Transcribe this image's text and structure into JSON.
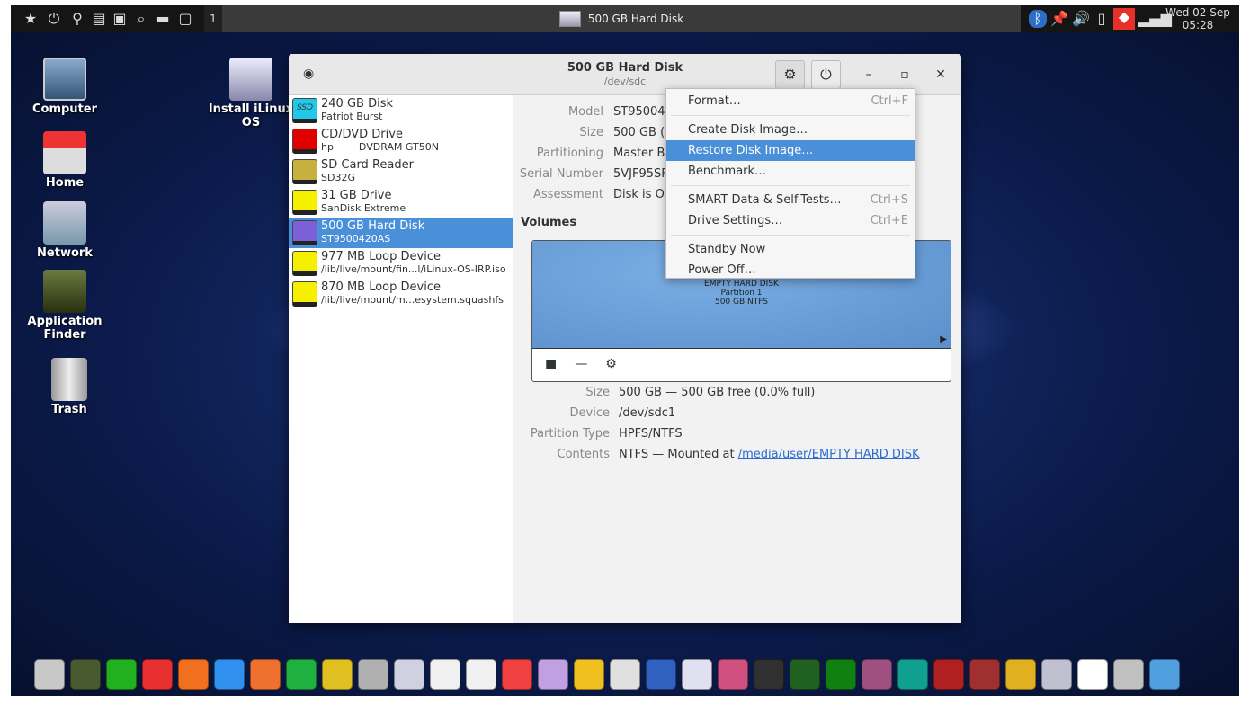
{
  "topbar": {
    "workspace": "1",
    "task_title": "500 GB Hard Disk",
    "clock_day": "Wed 02 Sep",
    "clock_time": "05:28",
    "launcher_icons": [
      "star-icon",
      "power-icon",
      "binoculars-icon",
      "drive-icon",
      "disk-utility-icon",
      "search-icon",
      "folder-icon",
      "window-icon"
    ],
    "tray_icons": [
      "bluetooth-icon",
      "pin-icon",
      "volume-icon",
      "battery-icon",
      "anydesk-icon",
      "signal-icon"
    ]
  },
  "desktop": {
    "icons": [
      {
        "label": "Computer"
      },
      {
        "label": "Install iLinux OS"
      },
      {
        "label": "Home"
      },
      {
        "label": "Network"
      },
      {
        "label": "Application Finder"
      },
      {
        "label": "Trash"
      }
    ]
  },
  "window": {
    "title": "500 GB Hard Disk",
    "subtitle": "/dev/sdc",
    "drives": [
      {
        "name": "240 GB Disk",
        "detail": "Patriot Burst",
        "icon": "ssd-icon",
        "color": "#22c8e8",
        "badge": "SSD"
      },
      {
        "name": "CD/DVD Drive",
        "detail": "hp        DVDRAM GT50N",
        "icon": "optical-drive-icon",
        "color": "#e00000"
      },
      {
        "name": "SD Card Reader",
        "detail": "SD32G",
        "icon": "sd-card-icon",
        "color": "#c8b040"
      },
      {
        "name": "31 GB Drive",
        "detail": "SanDisk Extreme",
        "icon": "drive-icon",
        "color": "#f5f000"
      },
      {
        "name": "500 GB Hard Disk",
        "detail": "ST9500420AS",
        "icon": "usb-drive-icon",
        "color": "#7b60d8",
        "selected": true
      },
      {
        "name": "977 MB Loop Device",
        "detail": "/lib/live/mount/fin...l/iLinux-OS-IRP.iso",
        "icon": "drive-icon",
        "color": "#f5f000"
      },
      {
        "name": "870 MB Loop Device",
        "detail": "/lib/live/mount/m...esystem.squashfs",
        "icon": "drive-icon",
        "color": "#f5f000"
      }
    ],
    "disk_info": [
      {
        "key": "Model",
        "value": "ST9500420AS (D005SDM1)"
      },
      {
        "key": "Size",
        "value": "500 GB (500,107,861,504 bytes)"
      },
      {
        "key": "Partitioning",
        "value": "Master Boot Record"
      },
      {
        "key": "Serial Number",
        "value": "5VJF95SF"
      },
      {
        "key": "Assessment",
        "value": "Disk is OK (28° C / 82° F)"
      }
    ],
    "volumes_heading": "Volumes",
    "partition": {
      "label": "EMPTY HARD DISK",
      "name": "Partition 1",
      "size": "500 GB NTFS"
    },
    "volume_info": [
      {
        "key": "Size",
        "value": "500 GB — 500 GB free (0.0% full)"
      },
      {
        "key": "Device",
        "value": "/dev/sdc1"
      },
      {
        "key": "Partition Type",
        "value": "HPFS/NTFS"
      },
      {
        "key": "Contents",
        "value": "NTFS — Mounted at ",
        "link": "/media/user/EMPTY HARD DISK"
      }
    ]
  },
  "menu": {
    "items": [
      {
        "label": "Format…",
        "shortcut": "Ctrl+F"
      },
      {
        "label": "Create Disk Image…",
        "shortcut": ""
      },
      {
        "label": "Restore Disk Image…",
        "shortcut": "",
        "highlighted": true
      },
      {
        "label": "Benchmark…",
        "shortcut": ""
      },
      {
        "label": "SMART Data & Self-Tests…",
        "shortcut": "Ctrl+S"
      },
      {
        "label": "Drive Settings…",
        "shortcut": "Ctrl+E"
      },
      {
        "label": "Standby Now",
        "shortcut": ""
      },
      {
        "label": "Power Off…",
        "shortcut": ""
      }
    ]
  },
  "dock": {
    "icons": [
      {
        "name": "file-cabinet-icon",
        "color": "#c8c8c8"
      },
      {
        "name": "binoculars-icon",
        "color": "#4a5a30"
      },
      {
        "name": "pipe-icon",
        "color": "#20b020"
      },
      {
        "name": "anydesk-icon",
        "color": "#e83030"
      },
      {
        "name": "firefox-icon",
        "color": "#f07020"
      },
      {
        "name": "wps-writer-icon",
        "color": "#3090f0"
      },
      {
        "name": "wps-presentation-icon",
        "color": "#f07030"
      },
      {
        "name": "wps-spreadsheet-icon",
        "color": "#20b040"
      },
      {
        "name": "teapot-icon",
        "color": "#e0c020"
      },
      {
        "name": "screenshot-icon",
        "color": "#b0b0b0"
      },
      {
        "name": "compass-icon",
        "color": "#d0d0e0"
      },
      {
        "name": "tools-icon",
        "color": "#f0f0f0"
      },
      {
        "name": "disk-usage-icon",
        "color": "#f0f0f0"
      },
      {
        "name": "health-monitor-icon",
        "color": "#f04040"
      },
      {
        "name": "color-picker-icon",
        "color": "#c0a0e0"
      },
      {
        "name": "magnifier-icon",
        "color": "#f0c020"
      },
      {
        "name": "download-drive-icon",
        "color": "#e0e0e0"
      },
      {
        "name": "installer-icon",
        "color": "#3060c0"
      },
      {
        "name": "installer-star-icon",
        "color": "#e0e0f0"
      },
      {
        "name": "sync-icon",
        "color": "#d05080"
      },
      {
        "name": "scanner-icon",
        "color": "#303030"
      },
      {
        "name": "system-monitor-icon",
        "color": "#206020"
      },
      {
        "name": "radar-icon",
        "color": "#108010"
      },
      {
        "name": "image-viewer-icon",
        "color": "#a05080"
      },
      {
        "name": "runner-icon",
        "color": "#10a090"
      },
      {
        "name": "terminal-red-icon",
        "color": "#b02020"
      },
      {
        "name": "terminal-icon",
        "color": "#a03030"
      },
      {
        "name": "lock-icon",
        "color": "#e0b020"
      },
      {
        "name": "usb-disc-icon",
        "color": "#c0c0d0"
      },
      {
        "name": "power-icon",
        "color": "#ffffff"
      },
      {
        "name": "trash-icon",
        "color": "#c0c0c0"
      },
      {
        "name": "desktop-icon",
        "color": "#50a0e0"
      }
    ]
  }
}
